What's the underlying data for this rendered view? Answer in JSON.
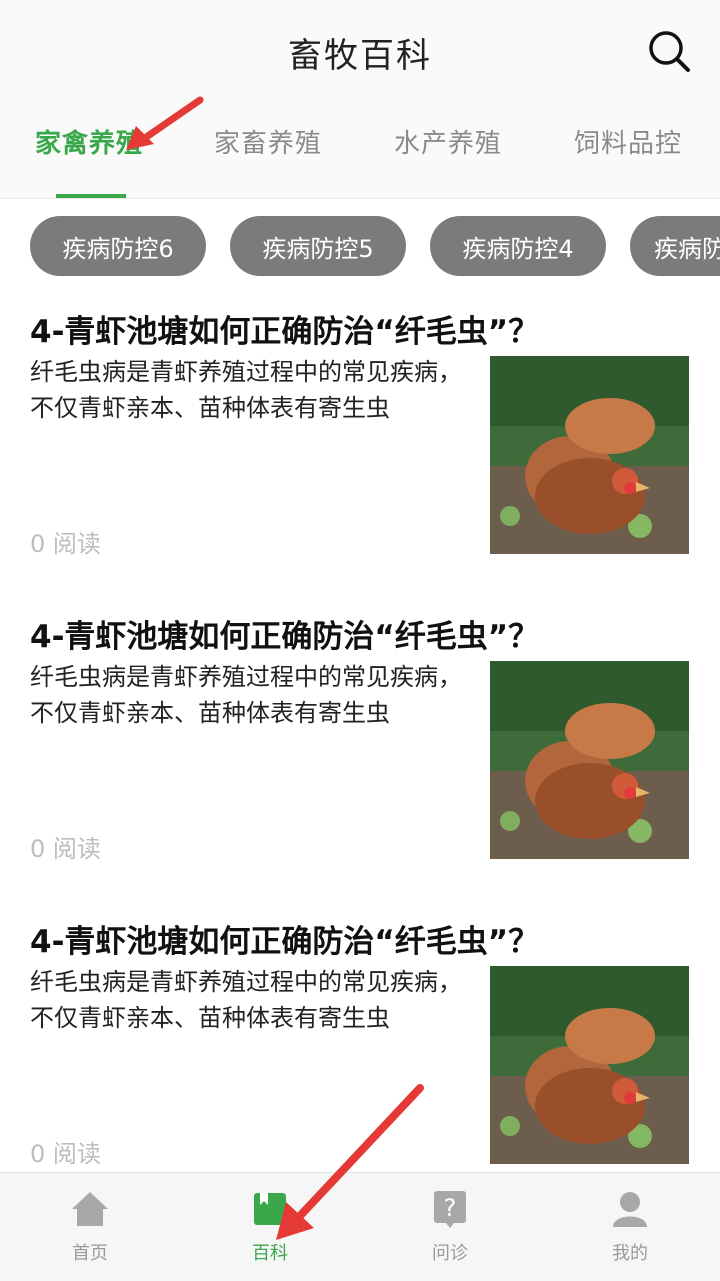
{
  "header": {
    "title": "畜牧百科"
  },
  "tabs": [
    {
      "label": "家禽养殖"
    },
    {
      "label": "家畜养殖"
    },
    {
      "label": "水产养殖"
    },
    {
      "label": "饲料品控"
    }
  ],
  "chips": [
    {
      "label": "疾病防控6"
    },
    {
      "label": "疾病防控5"
    },
    {
      "label": "疾病防控4"
    },
    {
      "label": "疾病防"
    }
  ],
  "articles": [
    {
      "title": "4-青虾池塘如何正确防治“纤毛虫”？",
      "summary": "纤毛虫病是青虾养殖过程中的常见疾病，不仅青虾亲本、苗种体表有寄生虫",
      "reads": "0 阅读"
    },
    {
      "title": "4-青虾池塘如何正确防治“纤毛虫”？",
      "summary": "纤毛虫病是青虾养殖过程中的常见疾病，不仅青虾亲本、苗种体表有寄生虫",
      "reads": "0 阅读"
    },
    {
      "title": "4-青虾池塘如何正确防治“纤毛虫”？",
      "summary": "纤毛虫病是青虾养殖过程中的常见疾病，不仅青虾亲本、苗种体表有寄生虫",
      "reads": "0 阅读"
    }
  ],
  "bottom_nav": [
    {
      "label": "首页",
      "icon": "home-icon"
    },
    {
      "label": "百科",
      "icon": "book-icon"
    },
    {
      "label": "问诊",
      "icon": "question-icon"
    },
    {
      "label": "我的",
      "icon": "user-icon"
    }
  ],
  "colors": {
    "accent": "#3aa84a",
    "chip_bg": "#7b7b7b",
    "annotation_arrow": "#e53935"
  }
}
